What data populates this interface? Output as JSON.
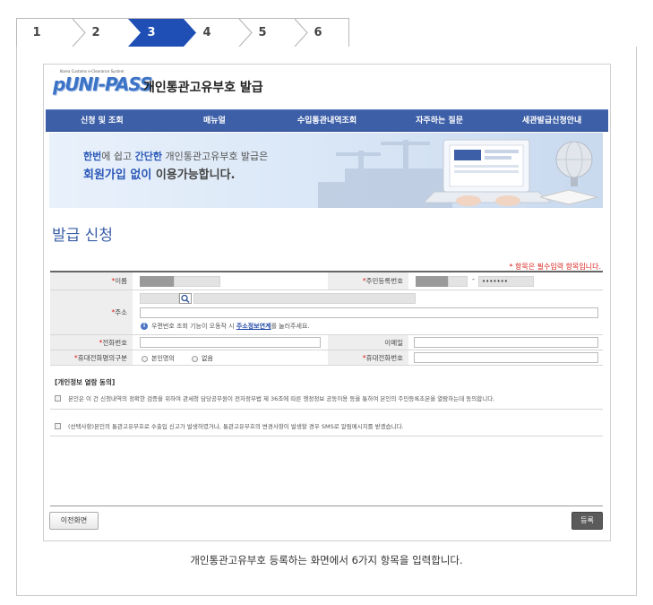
{
  "steps": {
    "items": [
      "1",
      "2",
      "3",
      "4",
      "5",
      "6"
    ],
    "active_index": 2
  },
  "colors": {
    "step_active": "#1f4fb5",
    "nav_bg": "#3d5fa8",
    "accent_blue": "#2a57b7",
    "required_red": "#d8201b",
    "submit_btn": "#5b5b5b"
  },
  "header": {
    "logo_small": "Korea Customs e-Clearance System",
    "logo_main": "pUNI-PASS",
    "title": "개인통관고유부호 발급"
  },
  "nav": {
    "items": [
      "신청 및 조회",
      "매뉴얼",
      "수입통관내역조회",
      "자주하는 질문",
      "세관발급신청안내"
    ]
  },
  "banner": {
    "line1_em1": "한번",
    "line1_t1": "에 쉽고 ",
    "line1_em2": "간단한",
    "line1_t2": " 개인통관고유부호 발급은",
    "line2_em1": "회원가입 없이",
    "line2_t1": " 이용가능합니다."
  },
  "page": {
    "title": "발급 신청",
    "required_note": "* 항목은 필수입력 항목입니다."
  },
  "form": {
    "required_mark": "*",
    "name_label": "이름",
    "rrn_label": "주민등록번호",
    "rrn_dash": "-",
    "rrn_back_mask": "•••••••",
    "address_label": "주소",
    "address_help_pre": "우편번호 조회 기능이 오동작 시",
    "address_help_link": "주소정보연계",
    "address_help_post": "를 눌러주세요.",
    "phone_label": "전화번호",
    "email_label": "이메일",
    "mobile_type_label": "휴대전화명의구분",
    "mobile_type_options": [
      "본인명의",
      "없음"
    ],
    "mobile_label": "휴대전화번호"
  },
  "consent": {
    "title": "[개인정보 열람 동의]",
    "item1": "본인은 이 건 신청내역의 정확한 검증을 위하여 관세청 담당공무원이 전자정부법 제 36조에 따른 행정정보 공동이용 등을 통하여 본인의 주민등록초본을 열람하는데 동의합니다.",
    "item2": "(선택사항)본인의 통관고유부호로 수출입 신고가 발생하였거나, 통관고유부호의 변경사항이 발생할 경우 SMS로 알림메시지를 받겠습니다."
  },
  "buttons": {
    "prev": "이전화면",
    "register": "등록"
  },
  "caption": "개인통관고유부호 등록하는 화면에서 6가지 항목을 입력합니다."
}
